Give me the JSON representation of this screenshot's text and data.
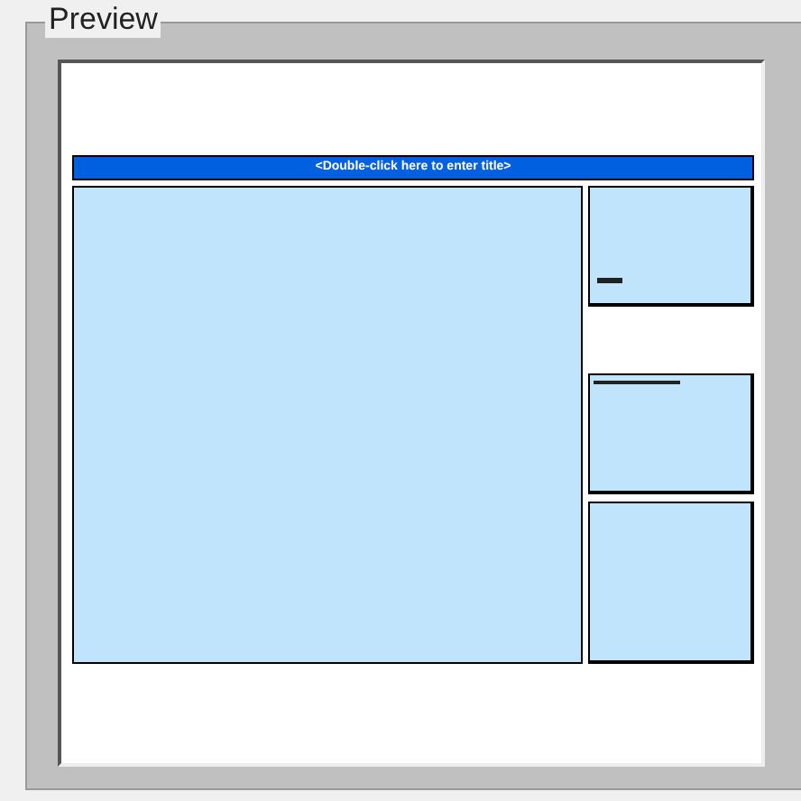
{
  "group": {
    "title": "Preview"
  },
  "preview": {
    "title_bar": "<Double-click here to enter title>"
  }
}
